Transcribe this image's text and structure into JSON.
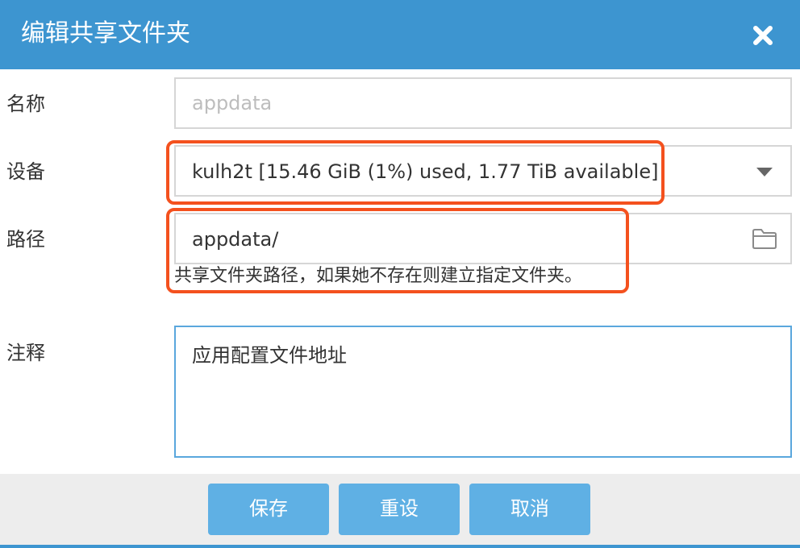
{
  "dialog": {
    "title": "编辑共享文件夹",
    "close_icon": "close-icon"
  },
  "form": {
    "name": {
      "label": "名称",
      "value": "",
      "placeholder": "appdata"
    },
    "device": {
      "label": "设备",
      "value": "kulh2t [15.46 GiB (1%) used, 1.77 TiB available]",
      "icon": "chevron-down-icon"
    },
    "path": {
      "label": "路径",
      "value": "appdata/",
      "hint": "共享文件夹路径，如果她不存在则建立指定文件夹。",
      "icon": "folder-icon"
    },
    "comment": {
      "label": "注释",
      "value": "应用配置文件地址"
    }
  },
  "buttons": {
    "save": "保存",
    "reset": "重设",
    "cancel": "取消"
  },
  "colors": {
    "header": "#3d95d0",
    "button": "#5fb0e4",
    "highlight": "#f4511e",
    "focus_border": "#5aa7dd"
  }
}
